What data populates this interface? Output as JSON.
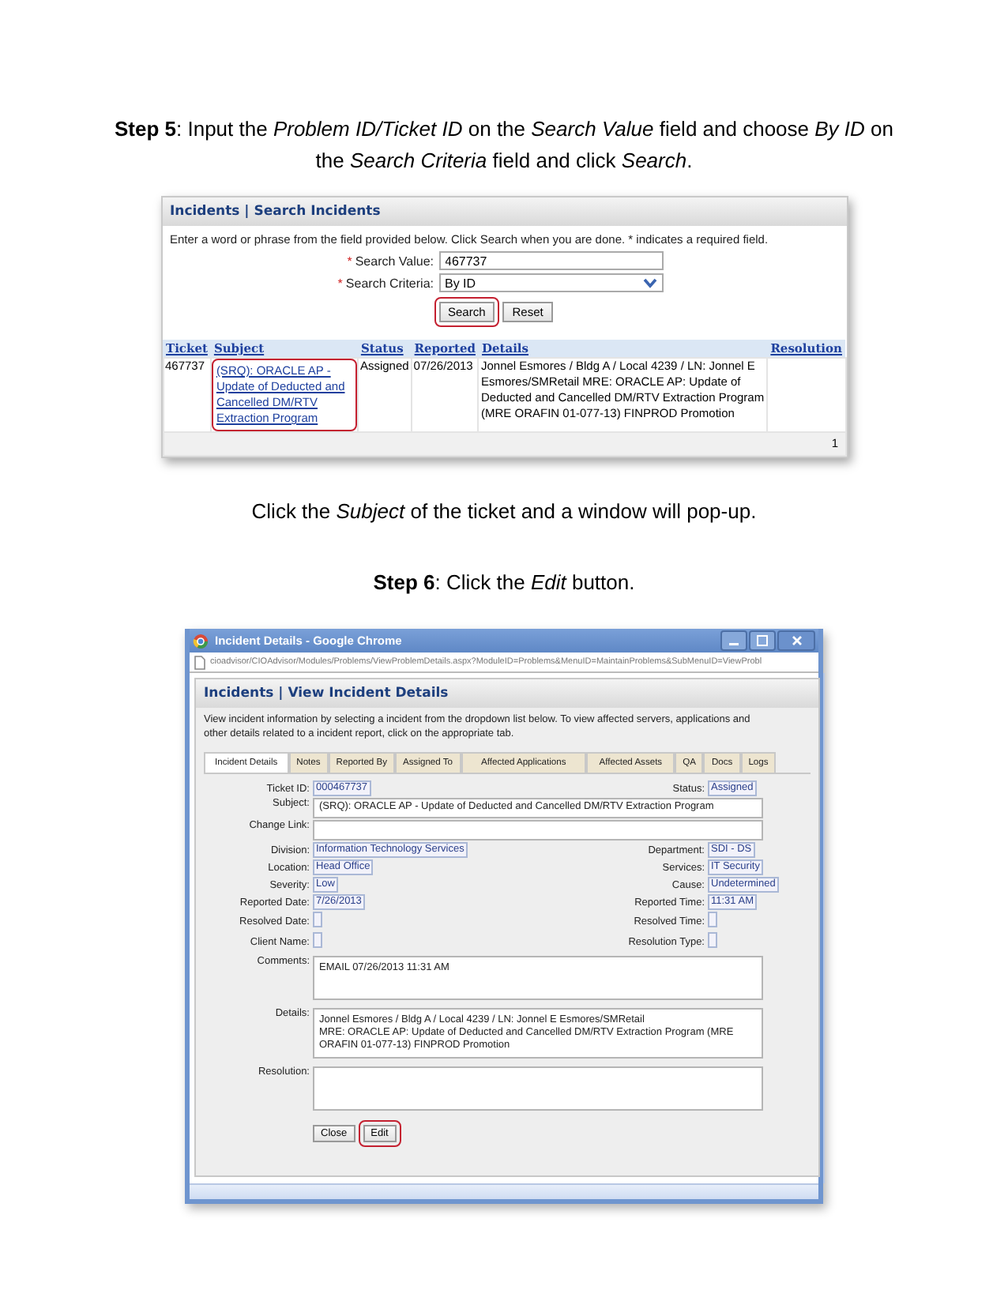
{
  "step5": "**Step 5**: Input the *Problem ID/Ticket ID* on the *Search Value* field and choose *By ID* on the *Search Criteria* field and click *Search*.",
  "search_panel": {
    "title": "Incidents | Search Incidents",
    "intro": "Enter a word or phrase from the field provided below. Click Search when you are done. * indicates a required field.",
    "fields": [
      {
        "kind": "text",
        "marker": "*",
        "label": "Search Value:",
        "value": "467737"
      },
      {
        "kind": "select",
        "marker": "*",
        "label": "Search Criteria:",
        "value": "By ID"
      }
    ],
    "buttons": [
      {
        "label": "Search",
        "highlighted": true
      },
      {
        "label": "Reset",
        "highlighted": false
      }
    ],
    "table": {
      "columns": [
        "Ticket",
        "Subject",
        "Status",
        "Reported",
        "Details",
        "Resolution"
      ],
      "rows": [
        {
          "ticket": "467737",
          "subject": "(SRQ): ORACLE AP - Update of Deducted and Cancelled DM/RTV Extraction Program",
          "subject_highlighted": true,
          "status": "Assigned",
          "reported": "07/26/2013",
          "details": "Jonnel Esmores / Bldg A / Local 4239 / LN: Jonnel E Esmores/SMRetail MRE: ORACLE AP: Update of Deducted and Cancelled DM/RTV Extraction Program (MRE ORAFIN 01-077-13) FINPROD Promotion"
        }
      ],
      "pager": "1"
    }
  },
  "caption": "Click the *Subject* of the ticket and a window will pop-up.",
  "step6": "**Step 6**: Click the *Edit* button.",
  "popup": {
    "title": "Incident Details - Google Chrome",
    "url": "cioadvisor/CIOAdvisor/Modules/Problems/ViewProblemDetails.aspx?ModuleID=Problems&MenuID=MaintainProblems&SubMenuID=ViewProbl",
    "panel_title": "Incidents | View Incident Details",
    "intro": "View incident information by selecting a incident from the dropdown list below. To view affected servers, applications and other details related to a incident report, click on the appropriate tab.",
    "tabs": [
      {
        "label": "Incident Details",
        "selected": true
      },
      {
        "label": "Notes",
        "selected": false
      },
      {
        "label": "Reported By",
        "selected": false
      },
      {
        "label": "Assigned To",
        "selected": false
      },
      {
        "label": "Affected Applications",
        "selected": false
      },
      {
        "label": "Affected Assets",
        "selected": false
      },
      {
        "label": "QA",
        "selected": false
      },
      {
        "label": "Docs",
        "selected": false
      },
      {
        "label": "Logs",
        "selected": false
      }
    ],
    "rows": [
      {
        "kind": "pair",
        "left": {
          "label": "Ticket ID:",
          "value": "000467737"
        },
        "right": {
          "label": "Status:",
          "value": "Assigned"
        }
      },
      {
        "kind": "textbox",
        "label": "Subject:",
        "value": "(SRQ): ORACLE AP - Update of Deducted and Cancelled DM/RTV Extraction Program"
      },
      {
        "kind": "textbox",
        "label": "Change Link:"
      },
      {
        "kind": "pair",
        "left": {
          "label": "Division:",
          "value": "Information Technology Services"
        },
        "right": {
          "label": "Department:",
          "value": "SDI - DS"
        }
      },
      {
        "kind": "pair",
        "left": {
          "label": "Location:",
          "value": "Head Office"
        },
        "right": {
          "label": "Services:",
          "value": "IT Security"
        }
      },
      {
        "kind": "pair",
        "left": {
          "label": "Severity:",
          "value": "Low"
        },
        "right": {
          "label": "Cause:",
          "value": "Undetermined"
        }
      },
      {
        "kind": "pair",
        "left": {
          "label": "Reported Date:",
          "value": "7/26/2013"
        },
        "right": {
          "label": "Reported Time:",
          "value": "11:31 AM"
        }
      },
      {
        "kind": "pair",
        "left": {
          "label": "Resolved Date:"
        },
        "right": {
          "label": "Resolved Time:"
        }
      },
      {
        "kind": "pair",
        "left": {
          "label": "Client Name:"
        },
        "right": {
          "label": "Resolution Type:"
        }
      },
      {
        "kind": "textarea",
        "label": "Comments:",
        "value": "EMAIL 07/26/2013 11:31 AM"
      },
      {
        "kind": "textarea",
        "label": "Details:",
        "value": "Jonnel Esmores / Bldg A / Local 4239 / LN: Jonnel E Esmores/SMRetail\nMRE: ORACLE AP: Update of Deducted and Cancelled DM/RTV Extraction Program (MRE ORAFIN 01-077-13) FINPROD Promotion"
      },
      {
        "kind": "textarea",
        "label": "Resolution:"
      }
    ],
    "buttons": [
      {
        "label": "Close",
        "highlighted": false
      },
      {
        "label": "Edit",
        "highlighted": true
      }
    ]
  }
}
